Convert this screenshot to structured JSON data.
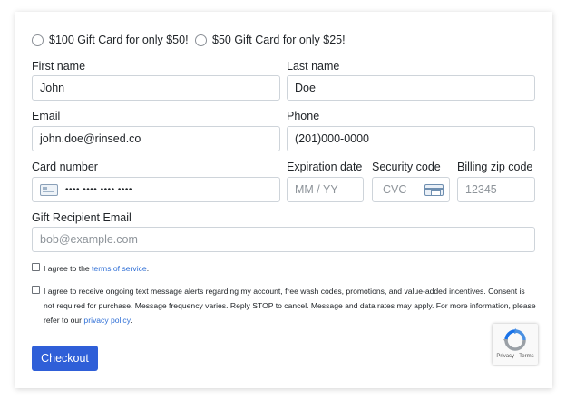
{
  "offers": [
    {
      "label": "$100 Gift Card for only $50!"
    },
    {
      "label": "$50 Gift Card for only $25!"
    }
  ],
  "form": {
    "first_name": {
      "label": "First name",
      "value": "John"
    },
    "last_name": {
      "label": "Last name",
      "value": "Doe"
    },
    "email": {
      "label": "Email",
      "value": "john.doe@rinsed.co"
    },
    "phone": {
      "label": "Phone",
      "value": "(201)000-0000"
    },
    "card_number": {
      "label": "Card number",
      "value": "•••• •••• •••• ••••"
    },
    "expiration": {
      "label": "Expiration date",
      "placeholder": "MM / YY"
    },
    "security_code": {
      "label": "Security code",
      "placeholder": "CVC"
    },
    "billing_zip": {
      "label": "Billing zip code",
      "placeholder": "12345"
    },
    "recipient_email": {
      "label": "Gift Recipient Email",
      "placeholder": "bob@example.com"
    }
  },
  "terms": {
    "prefix": "I agree to the ",
    "link": "terms of service",
    "suffix": "."
  },
  "sms": {
    "text": "I agree to receive ongoing text message alerts regarding my account, free wash codes, promotions, and value-added incentives. Consent is not required for purchase. Message frequency varies. Reply STOP to cancel. Message and data rates may apply. For more information, please refer to our ",
    "link": "privacy policy",
    "suffix": "."
  },
  "checkout_label": "Checkout",
  "recaptcha": {
    "text": "Privacy - Terms"
  },
  "colors": {
    "primary": "#2f5fd8",
    "link": "#2f6fd6",
    "border": "#ced4da"
  }
}
